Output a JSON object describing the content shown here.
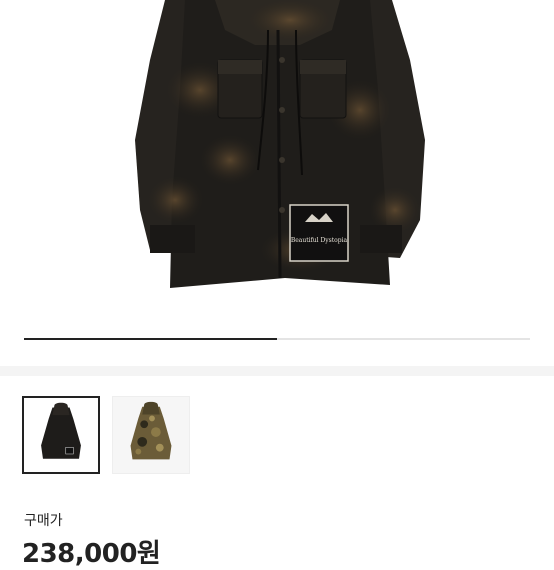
{
  "product": {
    "patch_text": "Beautiful Dystopia",
    "image_slider": {
      "current_index": 1,
      "total": 2,
      "progress_fraction": 0.5
    },
    "thumbnails": [
      {
        "name": "thumbnail-black-jacket",
        "selected": true
      },
      {
        "name": "thumbnail-camo-jacket",
        "selected": false
      }
    ]
  },
  "price": {
    "label": "구매가",
    "value": "238,000원"
  },
  "colors": {
    "text": "#222222",
    "divider": "#f4f4f4",
    "progress_track": "#e4e4e4",
    "progress_fill": "#222222"
  }
}
